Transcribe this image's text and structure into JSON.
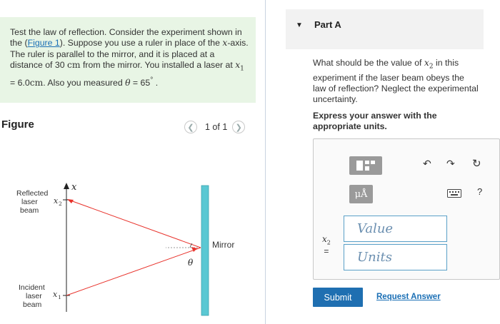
{
  "problem": {
    "p1": "Test the law of reflection. Consider the experiment shown in the (",
    "figure_link": "Figure 1",
    "p2": "). Suppose you use a ruler in place of the ",
    "x_axis_var": "x",
    "p3": "-axis. The ruler is parallel to the mirror, and it is placed at a distance of 30 ",
    "unit_cm": "cm",
    "p4": " from the mirror. You installed a laser at ",
    "x1_var": "x",
    "x1_sub": "1",
    "p5": " = 6.0",
    "unit_cm2": "cm",
    "p6": ". Also you measured ",
    "theta": "θ",
    "p7": " = 65",
    "degree": "°",
    "p8": " ."
  },
  "figure": {
    "title": "Figure",
    "pager": "1 of 1",
    "prev_icon": "chevron-left-icon",
    "next_icon": "chevron-right-icon",
    "labels": {
      "axis_x": "x",
      "x2": "x",
      "x2_sub": "2",
      "x1": "x",
      "x1_sub": "1",
      "reflected": [
        "Reflected",
        "laser",
        "beam"
      ],
      "incident": [
        "Incident",
        "laser",
        "beam"
      ],
      "mirror": "Mirror",
      "theta": "θ"
    },
    "colors": {
      "beam": "#e8312a",
      "mirror": "#5bc8d3"
    }
  },
  "part": {
    "title": "Part A",
    "collapse_icon": "caret-down-icon",
    "question": {
      "q1": "What should be the value of ",
      "x2_var": "x",
      "x2_sub": "2",
      "q2": " in this experiment if the laser beam obeys the law of reflection? Neglect the experimental uncertainty."
    },
    "express": "Express your answer with the appropriate units.",
    "toolbar": {
      "templates_icon": "templates-icon",
      "units_label": "μÅ",
      "undo_icon": "undo-icon",
      "redo_icon": "redo-icon",
      "reset_icon": "reset-icon",
      "keyboard_icon": "keyboard-icon",
      "help_label": "?"
    },
    "var_label": "x",
    "var_sub": "2",
    "var_eq": "=",
    "value_placeholder": "Value",
    "units_placeholder": "Units",
    "submit": "Submit",
    "request": "Request Answer"
  }
}
